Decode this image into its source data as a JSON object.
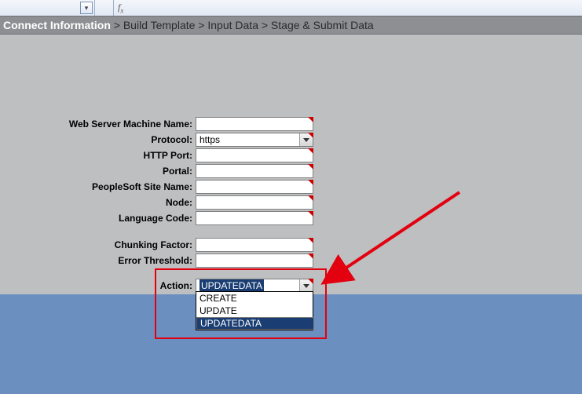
{
  "breadcrumb": {
    "active": "Connect Information",
    "rest": " > Build Template > Input Data > Stage & Submit Data"
  },
  "form": {
    "web_server_label": "Web Server Machine Name:",
    "protocol_label": "Protocol:",
    "protocol_value": "https",
    "http_port_label": "HTTP Port:",
    "portal_label": "Portal:",
    "site_name_label": "PeopleSoft Site Name:",
    "node_label": "Node:",
    "language_code_label": "Language Code:",
    "chunking_factor_label": "Chunking Factor:",
    "error_threshold_label": "Error Threshold:",
    "action_label": "Action:",
    "action_value": "UPDATEDATA",
    "action_options": {
      "0": "CREATE",
      "1": "UPDATE",
      "2": "UPDATEDATA"
    }
  }
}
